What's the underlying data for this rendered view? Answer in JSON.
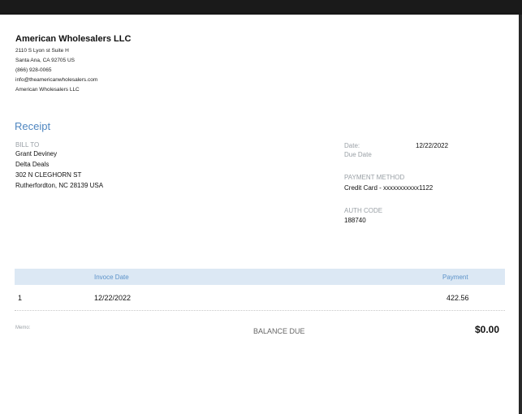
{
  "company": {
    "name": "American Wholesalers LLC",
    "address1": "2110 S Lyon st Suite H",
    "address2": "Santa Ana, CA  92705 US",
    "phone": "(866) 928-0065",
    "email": "info@theamericanwholesalers.com",
    "name2": "American Wholesalers LLC"
  },
  "receipt": {
    "title": "Receipt"
  },
  "bill_to": {
    "label": "BILL TO",
    "lines": [
      "Grant Deviney",
      "Delta Deals",
      "302 N CLEGHORN ST",
      "Rutherfordton, NC  28139 USA"
    ]
  },
  "meta": {
    "date_label": "Date:",
    "date_value": "12/22/2022",
    "due_label": "Due Date",
    "payment_method_label": "PAYMENT METHOD",
    "payment_method_value": "Credit Card - xxxxxxxxxxx1122",
    "auth_code_label": "AUTH CODE",
    "auth_code_value": "188740"
  },
  "table": {
    "headers": [
      "Invoce Date",
      "Payment"
    ],
    "rows": [
      {
        "num": "1",
        "date": "12/22/2022",
        "payment": "422.56"
      }
    ]
  },
  "footer": {
    "memo_label": "Memo:",
    "balance_label": "BALANCE DUE",
    "balance_amount": "$0.00"
  }
}
